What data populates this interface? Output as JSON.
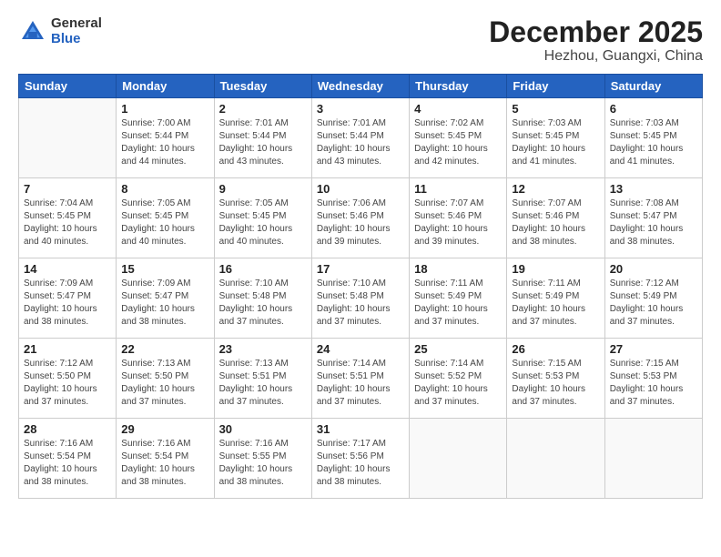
{
  "header": {
    "logo_general": "General",
    "logo_blue": "Blue",
    "title": "December 2025",
    "subtitle": "Hezhou, Guangxi, China"
  },
  "weekdays": [
    "Sunday",
    "Monday",
    "Tuesday",
    "Wednesday",
    "Thursday",
    "Friday",
    "Saturday"
  ],
  "weeks": [
    [
      {
        "day": "",
        "info": ""
      },
      {
        "day": "1",
        "info": "Sunrise: 7:00 AM\nSunset: 5:44 PM\nDaylight: 10 hours\nand 44 minutes."
      },
      {
        "day": "2",
        "info": "Sunrise: 7:01 AM\nSunset: 5:44 PM\nDaylight: 10 hours\nand 43 minutes."
      },
      {
        "day": "3",
        "info": "Sunrise: 7:01 AM\nSunset: 5:44 PM\nDaylight: 10 hours\nand 43 minutes."
      },
      {
        "day": "4",
        "info": "Sunrise: 7:02 AM\nSunset: 5:45 PM\nDaylight: 10 hours\nand 42 minutes."
      },
      {
        "day": "5",
        "info": "Sunrise: 7:03 AM\nSunset: 5:45 PM\nDaylight: 10 hours\nand 41 minutes."
      },
      {
        "day": "6",
        "info": "Sunrise: 7:03 AM\nSunset: 5:45 PM\nDaylight: 10 hours\nand 41 minutes."
      }
    ],
    [
      {
        "day": "7",
        "info": "Sunrise: 7:04 AM\nSunset: 5:45 PM\nDaylight: 10 hours\nand 40 minutes."
      },
      {
        "day": "8",
        "info": "Sunrise: 7:05 AM\nSunset: 5:45 PM\nDaylight: 10 hours\nand 40 minutes."
      },
      {
        "day": "9",
        "info": "Sunrise: 7:05 AM\nSunset: 5:45 PM\nDaylight: 10 hours\nand 40 minutes."
      },
      {
        "day": "10",
        "info": "Sunrise: 7:06 AM\nSunset: 5:46 PM\nDaylight: 10 hours\nand 39 minutes."
      },
      {
        "day": "11",
        "info": "Sunrise: 7:07 AM\nSunset: 5:46 PM\nDaylight: 10 hours\nand 39 minutes."
      },
      {
        "day": "12",
        "info": "Sunrise: 7:07 AM\nSunset: 5:46 PM\nDaylight: 10 hours\nand 38 minutes."
      },
      {
        "day": "13",
        "info": "Sunrise: 7:08 AM\nSunset: 5:47 PM\nDaylight: 10 hours\nand 38 minutes."
      }
    ],
    [
      {
        "day": "14",
        "info": "Sunrise: 7:09 AM\nSunset: 5:47 PM\nDaylight: 10 hours\nand 38 minutes."
      },
      {
        "day": "15",
        "info": "Sunrise: 7:09 AM\nSunset: 5:47 PM\nDaylight: 10 hours\nand 38 minutes."
      },
      {
        "day": "16",
        "info": "Sunrise: 7:10 AM\nSunset: 5:48 PM\nDaylight: 10 hours\nand 37 minutes."
      },
      {
        "day": "17",
        "info": "Sunrise: 7:10 AM\nSunset: 5:48 PM\nDaylight: 10 hours\nand 37 minutes."
      },
      {
        "day": "18",
        "info": "Sunrise: 7:11 AM\nSunset: 5:49 PM\nDaylight: 10 hours\nand 37 minutes."
      },
      {
        "day": "19",
        "info": "Sunrise: 7:11 AM\nSunset: 5:49 PM\nDaylight: 10 hours\nand 37 minutes."
      },
      {
        "day": "20",
        "info": "Sunrise: 7:12 AM\nSunset: 5:49 PM\nDaylight: 10 hours\nand 37 minutes."
      }
    ],
    [
      {
        "day": "21",
        "info": "Sunrise: 7:12 AM\nSunset: 5:50 PM\nDaylight: 10 hours\nand 37 minutes."
      },
      {
        "day": "22",
        "info": "Sunrise: 7:13 AM\nSunset: 5:50 PM\nDaylight: 10 hours\nand 37 minutes."
      },
      {
        "day": "23",
        "info": "Sunrise: 7:13 AM\nSunset: 5:51 PM\nDaylight: 10 hours\nand 37 minutes."
      },
      {
        "day": "24",
        "info": "Sunrise: 7:14 AM\nSunset: 5:51 PM\nDaylight: 10 hours\nand 37 minutes."
      },
      {
        "day": "25",
        "info": "Sunrise: 7:14 AM\nSunset: 5:52 PM\nDaylight: 10 hours\nand 37 minutes."
      },
      {
        "day": "26",
        "info": "Sunrise: 7:15 AM\nSunset: 5:53 PM\nDaylight: 10 hours\nand 37 minutes."
      },
      {
        "day": "27",
        "info": "Sunrise: 7:15 AM\nSunset: 5:53 PM\nDaylight: 10 hours\nand 37 minutes."
      }
    ],
    [
      {
        "day": "28",
        "info": "Sunrise: 7:16 AM\nSunset: 5:54 PM\nDaylight: 10 hours\nand 38 minutes."
      },
      {
        "day": "29",
        "info": "Sunrise: 7:16 AM\nSunset: 5:54 PM\nDaylight: 10 hours\nand 38 minutes."
      },
      {
        "day": "30",
        "info": "Sunrise: 7:16 AM\nSunset: 5:55 PM\nDaylight: 10 hours\nand 38 minutes."
      },
      {
        "day": "31",
        "info": "Sunrise: 7:17 AM\nSunset: 5:56 PM\nDaylight: 10 hours\nand 38 minutes."
      },
      {
        "day": "",
        "info": ""
      },
      {
        "day": "",
        "info": ""
      },
      {
        "day": "",
        "info": ""
      }
    ]
  ]
}
